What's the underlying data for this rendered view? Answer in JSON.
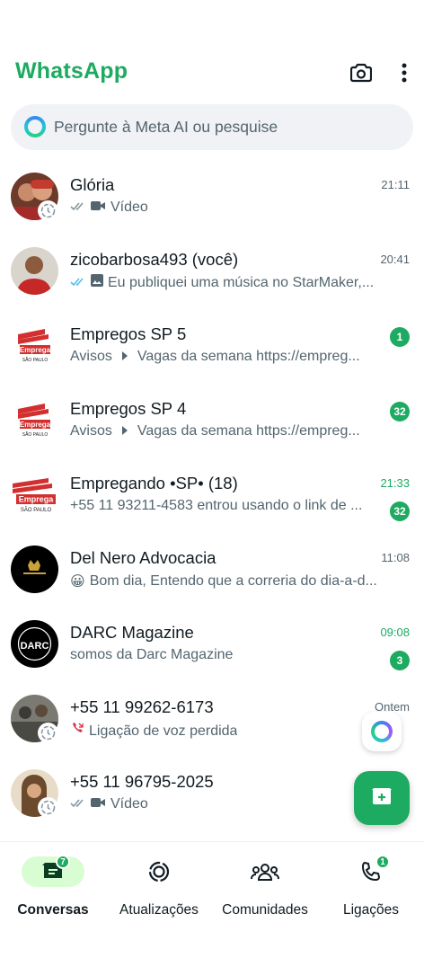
{
  "header": {
    "title": "WhatsApp",
    "camera_icon": "camera-icon",
    "menu_icon": "more-vertical-icon"
  },
  "search": {
    "placeholder": "Pergunte à Meta AI ou pesquise",
    "icon": "meta-ai-icon"
  },
  "colors": {
    "accent": "#1daa61",
    "read_tick": "#53bdeb",
    "missed_call": "#d93248",
    "active_tab_bg": "#d8fdd2"
  },
  "chats": [
    {
      "name": "Glória",
      "time": "21:11",
      "preview": "Vídeo",
      "has_status": true
    },
    {
      "name": "zicobarbosa493 (você)",
      "time": "20:41",
      "preview": "Eu publiquei uma música no StarMaker,..."
    },
    {
      "name": "Empregos SP 5",
      "sender": "Avisos",
      "preview": "Vagas da semana  https://empreg...",
      "unread": "1",
      "logo_text": "Emprega",
      "logo_sub": "SÃO PAULO"
    },
    {
      "name": "Empregos SP 4",
      "sender": "Avisos",
      "preview": "Vagas da semana  https://empreg...",
      "unread": "32",
      "logo_text": "Emprega",
      "logo_sub": "SÃO PAULO"
    },
    {
      "name": "Empregando •SP• (18)",
      "time": "21:33",
      "preview": "+55 11 93211-4583 entrou usando o link de ...",
      "unread": "32",
      "logo_text": "Emprega",
      "logo_sub": "SÃO PAULO"
    },
    {
      "name": "Del Nero Advocacia",
      "time": "11:08",
      "emoji": "😀",
      "preview": "Bom dia,  Entendo que a correria do dia-a-d..."
    },
    {
      "name": "DARC Magazine",
      "time": "09:08",
      "preview": "somos da Darc Magazine",
      "unread": "3",
      "logo_text": "DARC"
    },
    {
      "name": "+55 11 99262-6173",
      "time": "Ontem",
      "preview": "Ligação de voz perdida",
      "has_status": true
    },
    {
      "name": "+55 11 96795-2025",
      "preview": "Vídeo",
      "has_status": true
    }
  ],
  "nav": [
    {
      "label": "Conversas",
      "icon": "chats-icon",
      "badge": "7",
      "active": true
    },
    {
      "label": "Atualizações",
      "icon": "updates-icon"
    },
    {
      "label": "Comunidades",
      "icon": "communities-icon"
    },
    {
      "label": "Ligações",
      "icon": "calls-icon",
      "badge": "1"
    }
  ]
}
